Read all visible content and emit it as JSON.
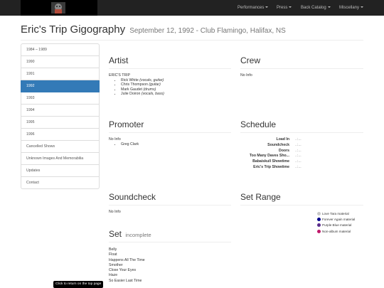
{
  "nav": {
    "items": [
      {
        "label": "Performances"
      },
      {
        "label": "Press"
      },
      {
        "label": "Back Catalog"
      },
      {
        "label": "Miscellany"
      }
    ]
  },
  "header": {
    "title": "Eric's Trip Gigography",
    "subtitle": "September 12, 1992 - Club Flamingo, Halifax, NS"
  },
  "sidebar": {
    "items": [
      {
        "label": "1984 – 1989"
      },
      {
        "label": "1990"
      },
      {
        "label": "1991"
      },
      {
        "label": "1992",
        "active": true
      },
      {
        "label": "1993"
      },
      {
        "label": "1994"
      },
      {
        "label": "1995"
      },
      {
        "label": "1996"
      },
      {
        "label": "Cancelled Shows"
      },
      {
        "label": "Unknown Images And Memorabilia"
      },
      {
        "label": "Updates"
      },
      {
        "label": "Contact"
      }
    ]
  },
  "artist": {
    "heading": "Artist",
    "band": "ERIC'S TRIP",
    "members": [
      {
        "name": "Rick White",
        "role": "(vocals, guitar)"
      },
      {
        "name": "Chris Thompson",
        "role": "(guitar)"
      },
      {
        "name": "Mark Gaudet",
        "role": "(drums)"
      },
      {
        "name": "Julie Doiron",
        "role": "(vocals, bass)"
      }
    ]
  },
  "crew": {
    "heading": "Crew",
    "text": "No Info"
  },
  "promoter": {
    "heading": "Promoter",
    "text": "No Info",
    "names": [
      "Greg Clark"
    ]
  },
  "schedule": {
    "heading": "Schedule",
    "rows": [
      {
        "label": "Load In",
        "value": "..:..."
      },
      {
        "label": "Soundcheck",
        "value": "..:..."
      },
      {
        "label": "Doors",
        "value": "..:..."
      },
      {
        "label": "Too Many Daves Sho...",
        "value": "..:..."
      },
      {
        "label": "Babaiskull Showtime",
        "value": "..:..."
      },
      {
        "label": "Eric's Trip Showtime",
        "value": "..:..."
      }
    ]
  },
  "soundcheck": {
    "heading": "Soundcheck",
    "text": "No Info"
  },
  "set_range": {
    "heading": "Set Range",
    "legend": [
      {
        "label": "Love Tara material",
        "color": "#c8c8c8"
      },
      {
        "label": "Forever Again material",
        "color": "#00008b"
      },
      {
        "label": "Purple Blue material",
        "color": "#5a2d8c"
      },
      {
        "label": "Non-album material",
        "color": "#c0186a"
      }
    ]
  },
  "set": {
    "heading": "Set",
    "status": "incomplete",
    "songs": [
      "Belly",
      "Float",
      "Happens All The Time",
      "Smother",
      "Close Your Eyes",
      "Haze",
      "So Easier Last Time"
    ]
  },
  "tooltip": {
    "text": "Click to return on the top page"
  }
}
